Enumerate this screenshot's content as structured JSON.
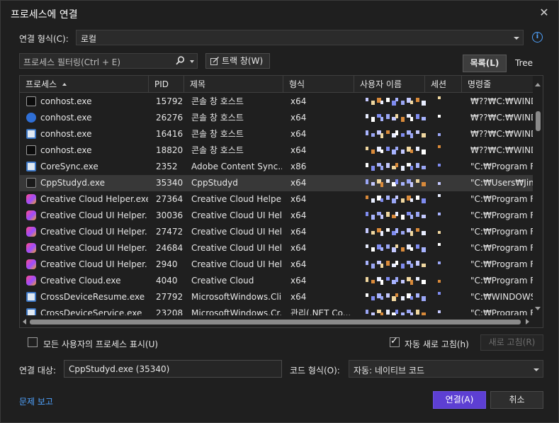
{
  "dialog": {
    "title": "프로세스에 연결",
    "close_glyph": "✕"
  },
  "connection": {
    "type_label": "연결 형식(C):",
    "type_value": "로컬"
  },
  "filter": {
    "placeholder": "프로세스 필터링(Ctrl + E)",
    "track_window_label": "트랙 창(W)"
  },
  "view": {
    "list_label": "목록(L)",
    "tree_label": "Tree"
  },
  "grid": {
    "columns": [
      "프로세스",
      "PID",
      "제목",
      "형식",
      "사용자 이름",
      "세션",
      "명령줄"
    ],
    "rows": [
      {
        "icon": "console-icon",
        "name": "conhost.exe",
        "pid": "15792",
        "title": "콘솔 창 호스트",
        "type": "x64",
        "cmd": "₩??₩C:₩WINDO"
      },
      {
        "icon": "globe-icon",
        "name": "conhost.exe",
        "pid": "26276",
        "title": "콘솔 창 호스트",
        "type": "x64",
        "cmd": "₩??₩C:₩WINDO"
      },
      {
        "icon": "window-icon",
        "name": "conhost.exe",
        "pid": "16416",
        "title": "콘솔 창 호스트",
        "type": "x64",
        "cmd": "₩??₩C:₩WINDO"
      },
      {
        "icon": "console-icon",
        "name": "conhost.exe",
        "pid": "18820",
        "title": "콘솔 창 호스트",
        "type": "x64",
        "cmd": "₩??₩C:₩WINDO"
      },
      {
        "icon": "window-icon",
        "name": "CoreSync.exe",
        "pid": "2352",
        "title": "Adobe Content Sync...",
        "type": "x86",
        "cmd": "\"C:₩Program Fi"
      },
      {
        "icon": "terminal-icon",
        "name": "CppStudyd.exe",
        "pid": "35340",
        "title": "CppStudyd",
        "type": "x64",
        "cmd": "\"C:₩Users₩Jinyo",
        "selected": true
      },
      {
        "icon": "creative-cloud-icon",
        "name": "Creative Cloud Helper.exe",
        "pid": "27364",
        "title": "Creative Cloud Helper",
        "type": "x64",
        "cmd": "\"C:₩Program Fi"
      },
      {
        "icon": "creative-cloud-icon",
        "name": "Creative Cloud UI Helper....",
        "pid": "30036",
        "title": "Creative Cloud UI Hel...",
        "type": "x64",
        "cmd": "\"C:₩Program Fi"
      },
      {
        "icon": "creative-cloud-icon",
        "name": "Creative Cloud UI Helper....",
        "pid": "27472",
        "title": "Creative Cloud UI Hel...",
        "type": "x64",
        "cmd": "\"C:₩Program Fi"
      },
      {
        "icon": "creative-cloud-icon",
        "name": "Creative Cloud UI Helper....",
        "pid": "24684",
        "title": "Creative Cloud UI Hel...",
        "type": "x64",
        "cmd": "\"C:₩Program Fi"
      },
      {
        "icon": "creative-cloud-icon",
        "name": "Creative Cloud UI Helper....",
        "pid": "2940",
        "title": "Creative Cloud UI Hel...",
        "type": "x64",
        "cmd": "\"C:₩Program Fi"
      },
      {
        "icon": "creative-cloud-icon",
        "name": "Creative Cloud.exe",
        "pid": "4040",
        "title": "Creative Cloud",
        "type": "x64",
        "cmd": "\"C:₩Program Fi"
      },
      {
        "icon": "window-icon",
        "name": "CrossDeviceResume.exe",
        "pid": "27792",
        "title": "MicrosoftWindows.Cli...",
        "type": "x64",
        "cmd": "\"C:₩WINDOWS"
      },
      {
        "icon": "window-icon",
        "name": "CrossDeviceService.exe",
        "pid": "23208",
        "title": "MicrosoftWindows.Cr...",
        "type": "관리(.NET Co...",
        "cmd": "\"C:₩Program Fi"
      }
    ]
  },
  "options": {
    "show_all_users_label": "모든 사용자의 프로세스 표시(U)",
    "show_all_users": false,
    "auto_refresh_label": "자동 새로 고침(h)",
    "auto_refresh": true,
    "refresh_label": "새로 고침(R)"
  },
  "target": {
    "label": "연결 대상:",
    "value": "CppStudyd.exe (35340)",
    "code_type_label": "코드 형식(O):",
    "code_type_value": "자동: 네이티브 코드"
  },
  "footer": {
    "report_label": "문제 보고",
    "attach_label": "연결(A)",
    "cancel_label": "취소"
  },
  "colors": {
    "accent": "#5d3fd3",
    "link": "#4fa3ff",
    "selection": "#383838"
  }
}
